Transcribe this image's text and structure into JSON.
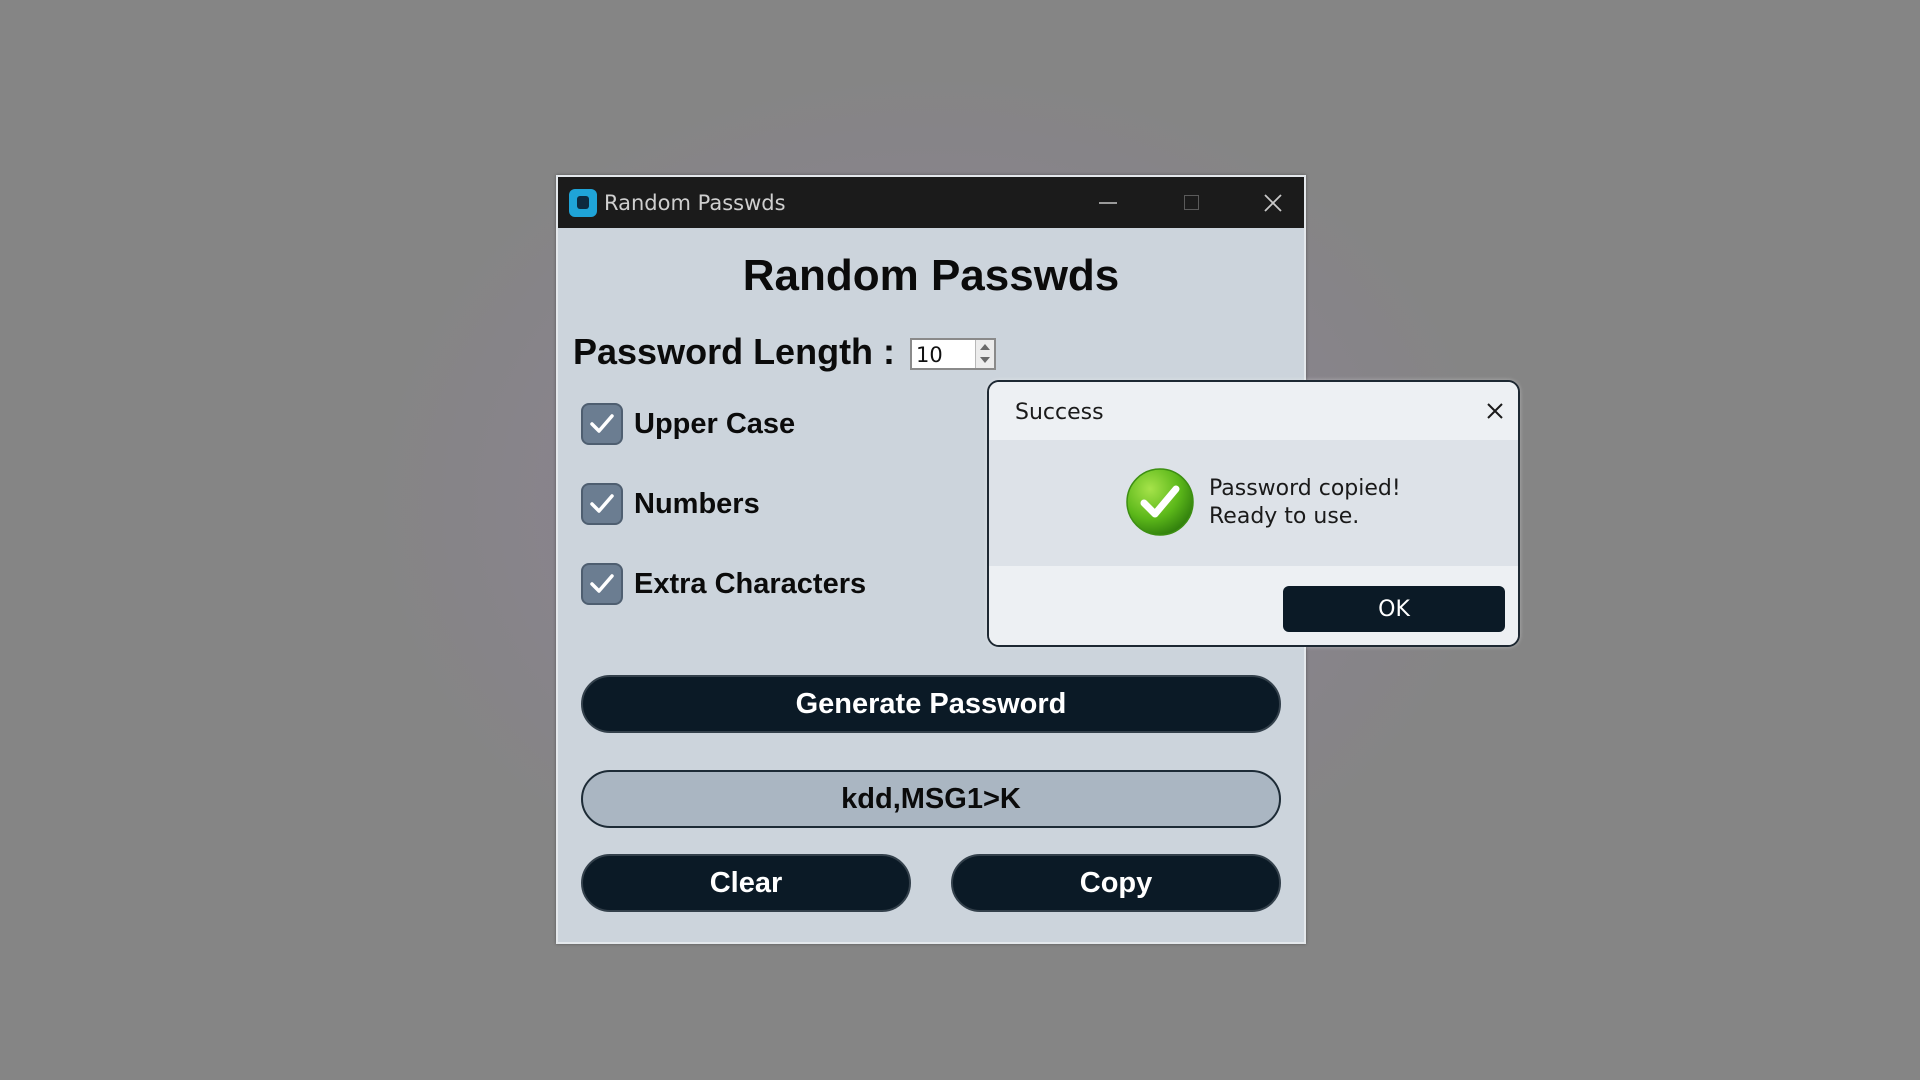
{
  "window": {
    "title": "Random Passwds",
    "controls": [
      "minimize",
      "maximize",
      "close"
    ]
  },
  "app": {
    "heading": "Random Passwds",
    "length_label": "Password Length :",
    "length_value": "10",
    "options": [
      {
        "label": "Upper Case",
        "checked": true
      },
      {
        "label": "Numbers",
        "checked": true
      },
      {
        "label": "Extra Characters",
        "checked": true
      }
    ],
    "generate_label": "Generate Password",
    "password_output": "kdd,MSG1>K",
    "clear_label": "Clear",
    "copy_label": "Copy"
  },
  "dialog": {
    "title": "Success",
    "message_line1": "Password copied!",
    "message_line2": "Ready to use.",
    "ok_label": "OK",
    "icon": "success-check-icon"
  },
  "colors": {
    "window_bg": "#ccd4dc",
    "titlebar_bg": "#1b1b1b",
    "button_bg": "#0b1a26",
    "checkbox_bg": "#6b7d91",
    "output_bg": "#aab6c2",
    "success_green": "#5cb81a"
  }
}
